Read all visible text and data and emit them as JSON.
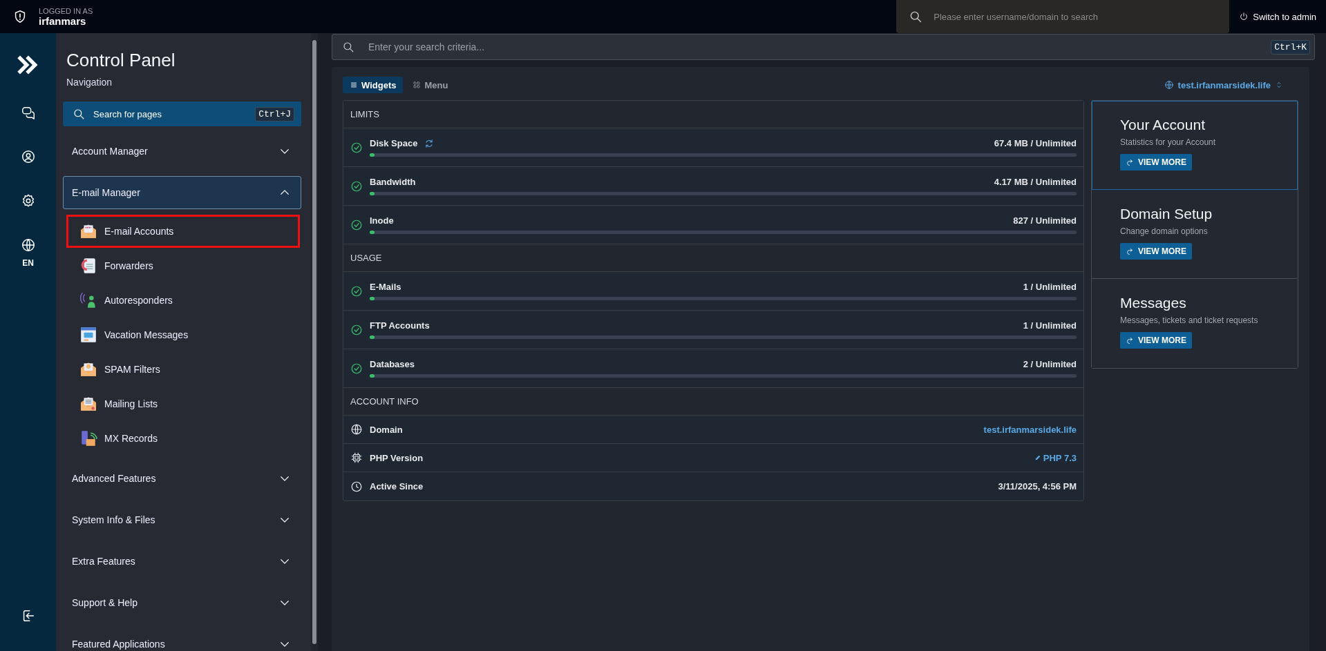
{
  "top_bar": {
    "logged_in_label": "LOGGED IN AS",
    "username": "irfanmars",
    "user_search": {
      "placeholder": "Please enter username/domain to search"
    },
    "switch_button": "Switch to admin"
  },
  "icon_rail": {
    "language": "EN"
  },
  "sidebar": {
    "title": "Control Panel",
    "subtitle": "Navigation",
    "search": {
      "label": "Search for pages",
      "shortcut": "Ctrl+J"
    },
    "sections": [
      {
        "label": "Account Manager",
        "expanded": false
      },
      {
        "label": "E-mail Manager",
        "expanded": true,
        "items": [
          {
            "label": "E-mail Accounts",
            "highlighted": true
          },
          {
            "label": "Forwarders",
            "highlighted": false
          },
          {
            "label": "Autoresponders",
            "highlighted": false
          },
          {
            "label": "Vacation Messages",
            "highlighted": false
          },
          {
            "label": "SPAM Filters",
            "highlighted": false
          },
          {
            "label": "Mailing Lists",
            "highlighted": false
          },
          {
            "label": "MX Records",
            "highlighted": false
          }
        ]
      },
      {
        "label": "Advanced Features",
        "expanded": false
      },
      {
        "label": "System Info & Files",
        "expanded": false
      },
      {
        "label": "Extra Features",
        "expanded": false
      },
      {
        "label": "Support & Help",
        "expanded": false
      },
      {
        "label": "Featured Applications",
        "expanded": false
      }
    ]
  },
  "search": {
    "placeholder": "Enter your search criteria...",
    "shortcut": "Ctrl+K"
  },
  "view_tabs": [
    {
      "label": "Widgets",
      "selected": true
    },
    {
      "label": "Menu",
      "selected": false
    }
  ],
  "domain_selector": "test.irfanmarsidek.life",
  "limits": {
    "heading": "LIMITS",
    "rows": [
      {
        "label": "Disk Space",
        "value": "67.4 MB / Unlimited",
        "level": 0.007,
        "refreshable": true
      },
      {
        "label": "Bandwidth",
        "value": "4.17 MB / Unlimited",
        "level": 0.007,
        "refreshable": false
      },
      {
        "label": "Inode",
        "value": "827 / Unlimited",
        "level": 0.007,
        "refreshable": false
      }
    ]
  },
  "usage": {
    "heading": "USAGE",
    "rows": [
      {
        "label": "E-Mails",
        "value": "1 / Unlimited",
        "level": 0.007,
        "refreshable": false
      },
      {
        "label": "FTP Accounts",
        "value": "1 / Unlimited",
        "level": 0.007,
        "refreshable": false
      },
      {
        "label": "Databases",
        "value": "2 / Unlimited",
        "level": 0.007,
        "refreshable": false
      }
    ]
  },
  "account_info": {
    "heading": "ACCOUNT INFO",
    "rows": [
      {
        "kind": "domain",
        "label": "Domain",
        "value": "test.irfanmarsidek.life"
      },
      {
        "kind": "php",
        "label": "PHP Version",
        "value": "PHP 7.3"
      },
      {
        "kind": "time",
        "label": "Active Since",
        "value": "3/11/2025, 4:56 PM"
      }
    ]
  },
  "cards": [
    {
      "title": "Your Account",
      "description": "Statistics for your Account",
      "button": "VIEW MORE",
      "highlighted": true
    },
    {
      "title": "Domain Setup",
      "description": "Change domain options",
      "button": "VIEW MORE",
      "highlighted": false
    },
    {
      "title": "Messages",
      "description": "Messages, tickets and ticket requests",
      "button": "VIEW MORE",
      "highlighted": false
    }
  ]
}
